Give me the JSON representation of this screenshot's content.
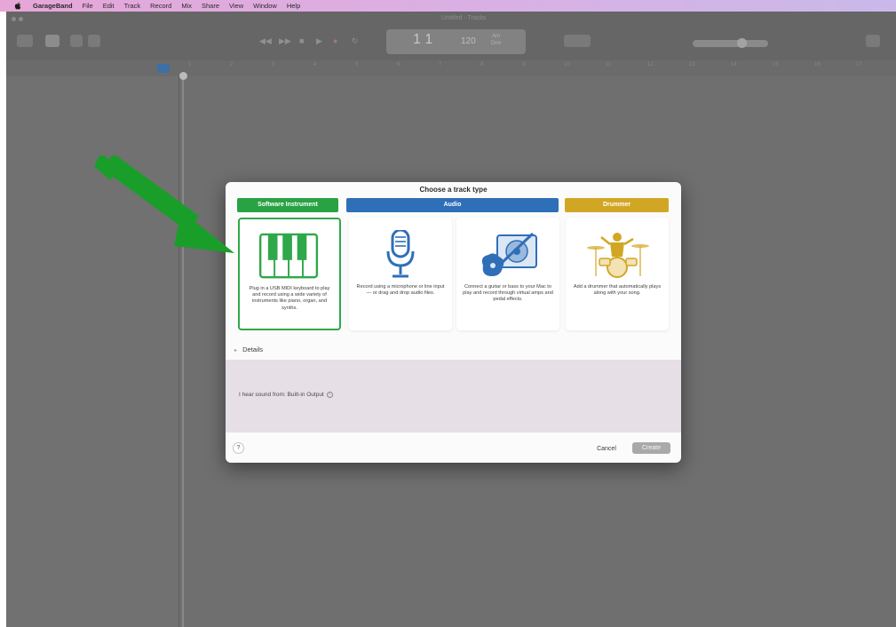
{
  "menubar": {
    "items": [
      "GarageBand",
      "File",
      "Edit",
      "Track",
      "Record",
      "Mix",
      "Share",
      "View",
      "Window",
      "Help"
    ]
  },
  "window": {
    "title": "Untitled - Tracks"
  },
  "lcd": {
    "position": "1 1",
    "tempo": "120",
    "key_top": "Am",
    "key_bottom": "Drm"
  },
  "ruler": {
    "ticks": [
      "1",
      "2",
      "3",
      "4",
      "5",
      "6",
      "7",
      "8",
      "9",
      "10",
      "11",
      "12",
      "13",
      "14",
      "15",
      "16",
      "17"
    ]
  },
  "dialog": {
    "title": "Choose a track type",
    "categories": {
      "software": "Software Instrument",
      "audio": "Audio",
      "drummer": "Drummer"
    },
    "cards": [
      {
        "name": "software-instrument-card",
        "desc": "Plug in a USB MIDI keyboard to play and record using a wide variety of instruments like piano, organ, and synths."
      },
      {
        "name": "microphone-card",
        "desc": "Record using a microphone or line input — or drag and drop audio files."
      },
      {
        "name": "guitar-bass-card",
        "desc": "Connect a guitar or bass to your Mac to play and record through virtual amps and pedal effects."
      },
      {
        "name": "drummer-card",
        "desc": "Add a drummer that automatically plays along with your song."
      }
    ],
    "details_label": "Details",
    "output_text": "I hear sound from: Built-in Output",
    "help_label": "?",
    "cancel_label": "Cancel",
    "create_label": "Create"
  },
  "colors": {
    "software": "#29a244",
    "audio": "#2f6fb7",
    "drummer": "#d2a625",
    "selected_border": "#2ea84a",
    "arrow": "#1a9e2a"
  }
}
